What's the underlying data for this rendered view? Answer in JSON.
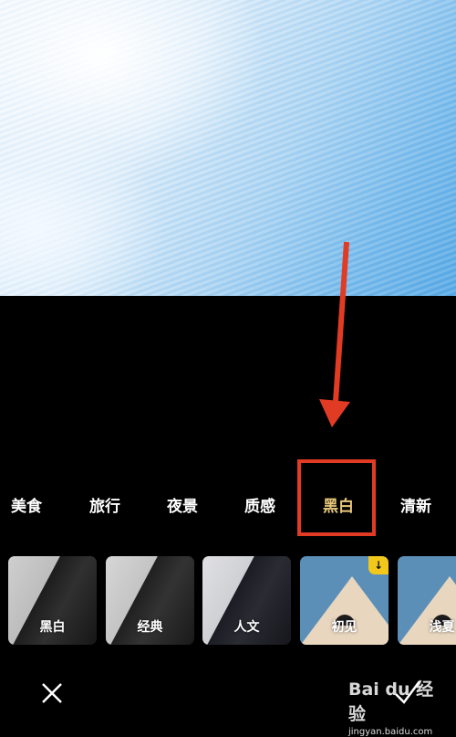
{
  "preview": {
    "description": "blue sky with clouds photo preview"
  },
  "categories": [
    {
      "label": "美食",
      "active": false
    },
    {
      "label": "旅行",
      "active": false
    },
    {
      "label": "夜景",
      "active": false
    },
    {
      "label": "质感",
      "active": false
    },
    {
      "label": "黑白",
      "active": true
    },
    {
      "label": "清新",
      "active": false
    }
  ],
  "filters": [
    {
      "label": "黑白",
      "style": "bw",
      "downloadable": false
    },
    {
      "label": "经典",
      "style": "bw2",
      "downloadable": false
    },
    {
      "label": "人文",
      "style": "bw3",
      "downloadable": false
    },
    {
      "label": "初见",
      "style": "house",
      "downloadable": true
    },
    {
      "label": "浅夏",
      "style": "house",
      "downloadable": false
    }
  ],
  "download_badge_icon": "↓",
  "actions": {
    "cancel_icon": "close-icon",
    "confirm_icon": "check-icon"
  },
  "watermark": {
    "brand": "Bai du 经验",
    "url": "jingyan.baidu.com"
  },
  "colors": {
    "active_category": "#e7c77a",
    "annotation": "#e23b24",
    "badge": "#f2c81b"
  }
}
